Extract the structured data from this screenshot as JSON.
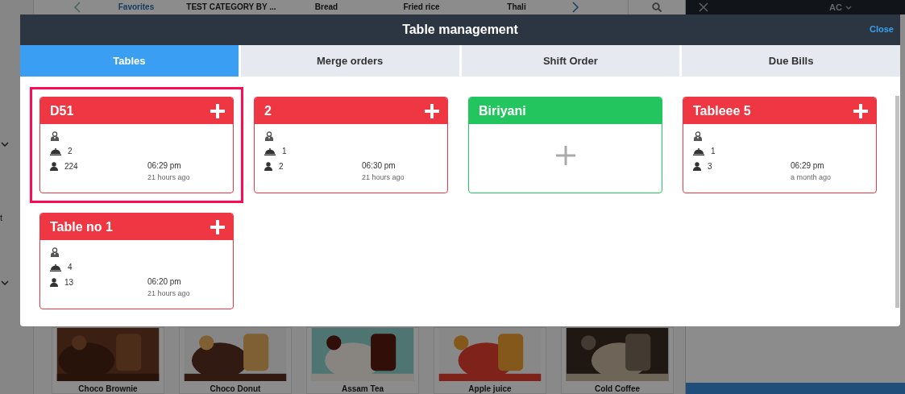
{
  "background": {
    "categories": [
      "Favorites",
      "TEST CATEGORY BY ...",
      "Bread",
      "Fried rice",
      "Thali"
    ],
    "panel_title": "AC",
    "sidebar_fragment": "t",
    "products": [
      {
        "name": "Choco Brownie"
      },
      {
        "name": "Choco Donut"
      },
      {
        "name": "Assam Tea"
      },
      {
        "name": "Apple juice"
      },
      {
        "name": "Cold Coffee"
      }
    ]
  },
  "modal": {
    "title": "Table management",
    "close": "Close",
    "tabs": [
      {
        "label": "Tables",
        "selected": true
      },
      {
        "label": "Merge orders",
        "selected": false
      },
      {
        "label": "Shift Order",
        "selected": false
      },
      {
        "label": "Due Bills",
        "selected": false
      }
    ],
    "tables": [
      {
        "name": "D51",
        "kind": "occupied",
        "selected": true,
        "items": "2",
        "guests": "224",
        "time": "06:29 pm",
        "ago": "21 hours ago"
      },
      {
        "name": "2",
        "kind": "occupied",
        "selected": false,
        "items": "1",
        "guests": "2",
        "time": "06:30 pm",
        "ago": "21 hours ago"
      },
      {
        "name": "Biriyani",
        "kind": "free",
        "selected": false
      },
      {
        "name": "Tableee 5",
        "kind": "occupied",
        "selected": false,
        "items": "1",
        "guests": "3",
        "time": "06:29 pm",
        "ago": "a month ago"
      },
      {
        "name": "Table no 1",
        "kind": "occupied",
        "selected": false,
        "items": "4",
        "guests": "13",
        "time": "06:20 pm",
        "ago": "21 hours ago"
      }
    ]
  }
}
